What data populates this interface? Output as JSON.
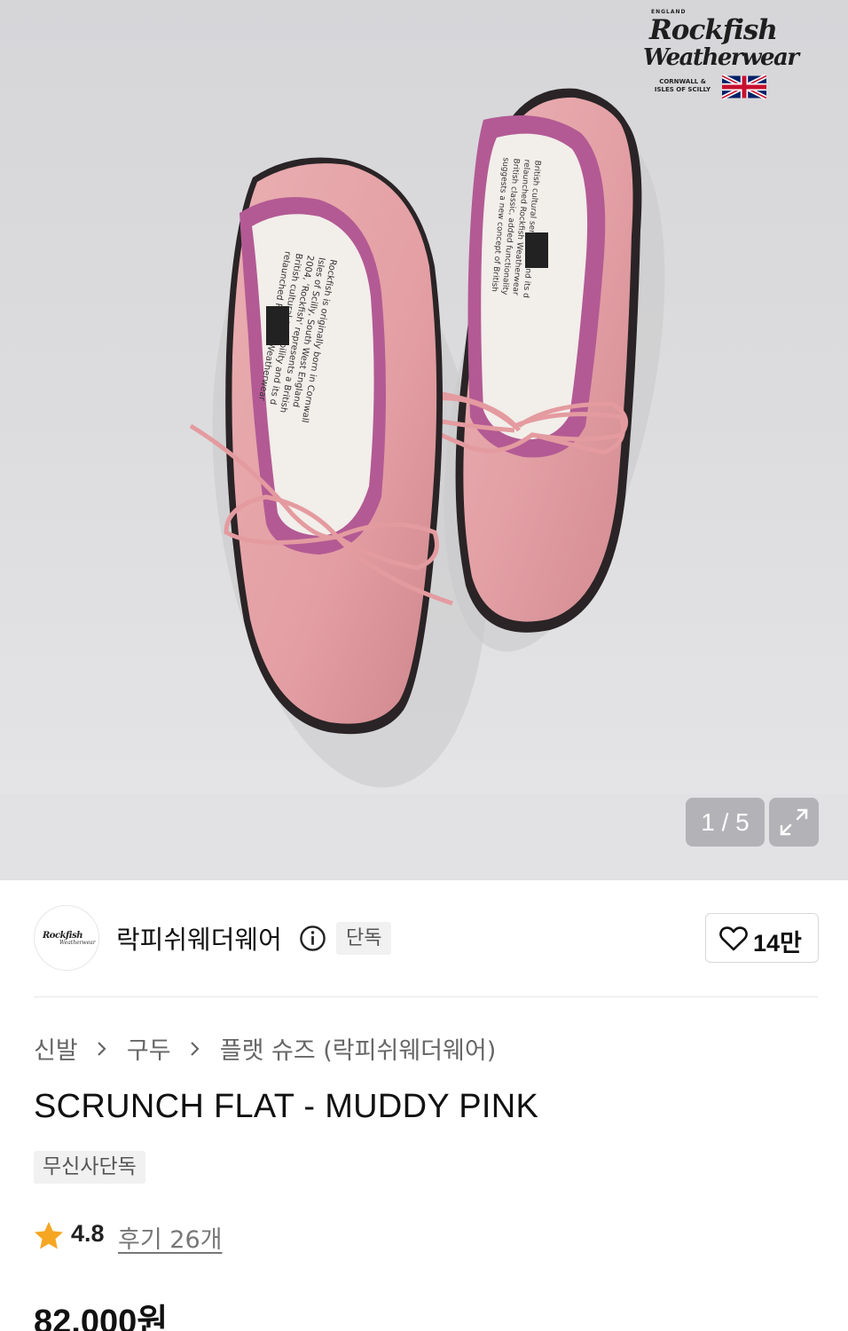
{
  "gallery": {
    "brand_logo": {
      "line0": "ENGLAND",
      "line1": "Rockfish",
      "line2": "Weatherwear",
      "line3": "CORNWALL & ISLES OF SCILLY"
    },
    "counter": "1 / 5",
    "expand_icon": "expand-icon"
  },
  "brand": {
    "avatar_line1": "Rockfish",
    "avatar_line2": "Weatherwear",
    "name": "락피쉬웨더웨어",
    "info_icon": "info-icon",
    "badge": "단독",
    "like_count": "14만",
    "like_icon": "heart-icon"
  },
  "breadcrumb": {
    "items": [
      "신발",
      "구두",
      "플랫 슈즈 (락피쉬웨더웨어)"
    ]
  },
  "product": {
    "title": "SCRUNCH FLAT - MUDDY PINK",
    "tag": "무신사단독",
    "rating": "4.8",
    "reviews": "후기 26개",
    "price": "82,000원"
  },
  "colors": {
    "star": "#f5a623",
    "shoe_pink": "#e8a3a8",
    "ruffle_mauve": "#b35a94"
  }
}
